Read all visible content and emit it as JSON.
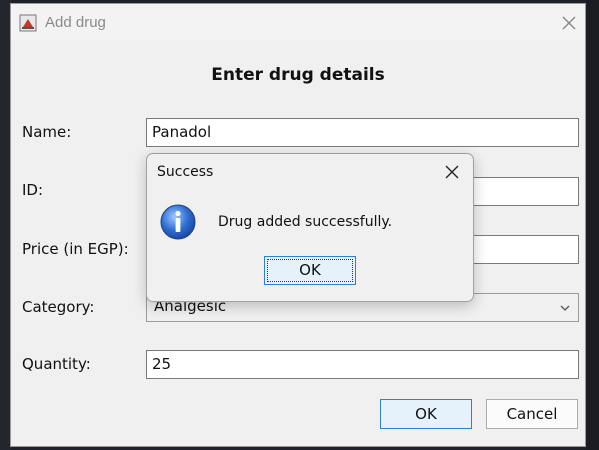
{
  "window": {
    "title": "Add drug",
    "close_icon": "close-icon",
    "app_icon": "java-app-icon"
  },
  "form": {
    "heading": "Enter drug details",
    "fields": {
      "name": {
        "label": "Name:",
        "value": "Panadol"
      },
      "id": {
        "label": "ID:",
        "value": ""
      },
      "price": {
        "label": "Price (in EGP):",
        "value": ""
      },
      "category": {
        "label": "Category:",
        "value": "Analgesic"
      },
      "quantity": {
        "label": "Quantity:",
        "value": "25"
      }
    },
    "buttons": {
      "ok": "OK",
      "cancel": "Cancel"
    }
  },
  "message_dialog": {
    "title": "Success",
    "message": "Drug added successfully.",
    "ok": "OK",
    "icon": "info-icon"
  },
  "colors": {
    "dialog_bg": "#f0f0f0",
    "accent": "#2f7fd6",
    "primary_button_bg": "#e5f1fb",
    "background_app": "#1e2128"
  }
}
